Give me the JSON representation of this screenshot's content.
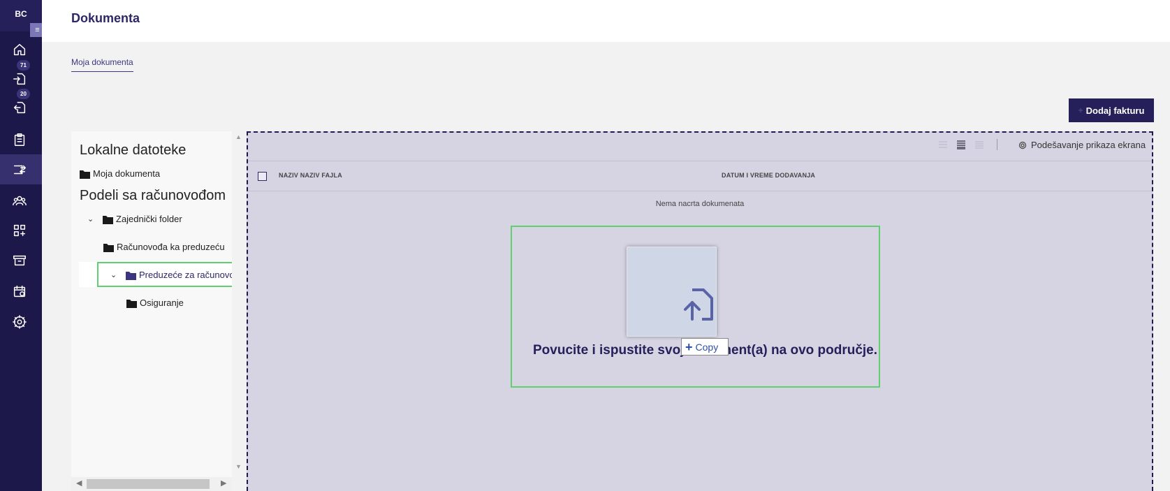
{
  "sidebar": {
    "logo": "BC",
    "collapse_icon": "collapse-menu-icon",
    "badges": {
      "incoming": "71",
      "outgoing": "20"
    },
    "icons": [
      "home-icon",
      "incoming-documents-icon",
      "outgoing-documents-icon",
      "clipboard-icon",
      "document-exchange-icon",
      "users-icon",
      "apps-icon",
      "archive-icon",
      "calendar-icon",
      "settings-icon"
    ]
  },
  "header": {
    "title": "Dokumenta"
  },
  "tabs": [
    {
      "label": "Moja dokumenta",
      "active": true
    }
  ],
  "actions": {
    "add_invoice": "Dodaj fakturu"
  },
  "tree": {
    "heading_local": "Lokalne datoteke",
    "local_items": [
      {
        "label": "Moja dokumenta"
      }
    ],
    "heading_shared": "Podeli sa računovođom",
    "shared_items": [
      {
        "label": "Zajednički folder",
        "expanded": true
      },
      {
        "label": "Računovođa ka preduzeću"
      },
      {
        "label": "Preduzeće za računovo",
        "expanded": true,
        "selected": true
      },
      {
        "label": "Osiguranje"
      }
    ]
  },
  "grid": {
    "settings_label": "Podešavanje prikaza ekrana",
    "columns": [
      "NAZIV NAZIV FAJLA",
      "DATUM I VREME DODAVANJA"
    ],
    "empty_message": "Nema nacrta dokumenata"
  },
  "dropzone": {
    "text": "Povucite i ispustite svoj dokument(a) na ovo područje.",
    "copy_tooltip": "Copy"
  },
  "colors": {
    "sidebar": "#1c1849",
    "accent": "#25205a",
    "highlight": "#5fcf6f",
    "drop_bg": "#d6d4e2"
  }
}
